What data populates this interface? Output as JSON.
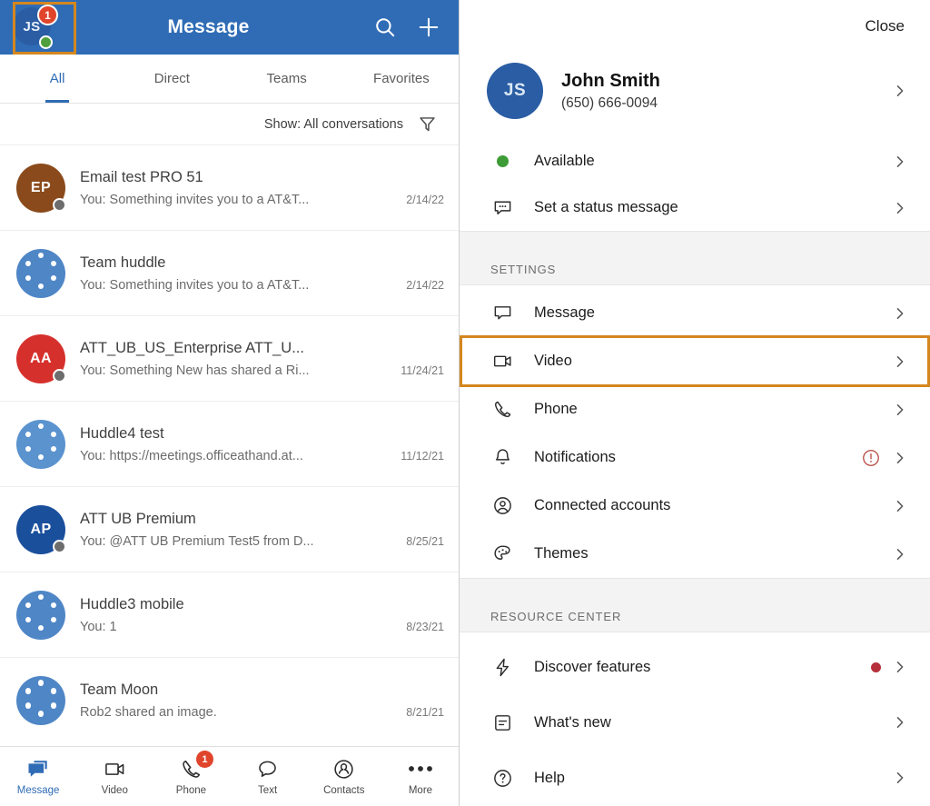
{
  "left": {
    "header": {
      "title": "Message",
      "avatar_initials": "JS",
      "badge_count": "1",
      "search_icon": "search-icon",
      "add_icon": "plus-icon"
    },
    "tabs": [
      {
        "label": "All",
        "active": true
      },
      {
        "label": "Direct",
        "active": false
      },
      {
        "label": "Teams",
        "active": false
      },
      {
        "label": "Favorites",
        "active": false
      }
    ],
    "filter": {
      "label": "Show: All conversations",
      "icon": "filter-funnel-icon"
    },
    "conversations": [
      {
        "title": "Email test PRO 51",
        "snippet": "You: Something invites you to a AT&T...",
        "date": "2/14/22",
        "avatar_type": "initials",
        "initials": "EP",
        "color": "#8a4a1b",
        "presence": true
      },
      {
        "title": "Team huddle",
        "snippet": "You: Something invites you to a AT&T...",
        "date": "2/14/22",
        "avatar_type": "team",
        "initials": "",
        "color": "#4f86c6",
        "presence": false
      },
      {
        "title": "ATT_UB_US_Enterprise ATT_U...",
        "snippet": "You: Something New has shared a Ri...",
        "date": "11/24/21",
        "avatar_type": "initials",
        "initials": "AA",
        "color": "#d6302c",
        "presence": true
      },
      {
        "title": "Huddle4 test",
        "snippet": "You: https://meetings.officeathand.at...",
        "date": "11/12/21",
        "avatar_type": "team",
        "initials": "",
        "color": "#5b93cf",
        "presence": false
      },
      {
        "title": "ATT UB Premium",
        "snippet": "You: @ATT UB Premium Test5 from D...",
        "date": "8/25/21",
        "avatar_type": "initials",
        "initials": "AP",
        "color": "#1a4f9c",
        "presence": true
      },
      {
        "title": "Huddle3 mobile",
        "snippet": "You: 1",
        "date": "8/23/21",
        "avatar_type": "team",
        "initials": "",
        "color": "#4f86c6",
        "presence": false
      },
      {
        "title": "Team Moon",
        "snippet": "Rob2 shared an image.",
        "date": "8/21/21",
        "avatar_type": "team",
        "initials": "",
        "color": "#4f86c6",
        "presence": false
      }
    ],
    "bottom_nav": [
      {
        "label": "Message",
        "icon": "message-icon",
        "active": true,
        "badge": ""
      },
      {
        "label": "Video",
        "icon": "video-camera-icon",
        "active": false,
        "badge": ""
      },
      {
        "label": "Phone",
        "icon": "phone-handset-icon",
        "active": false,
        "badge": "1"
      },
      {
        "label": "Text",
        "icon": "speech-bubble-icon",
        "active": false,
        "badge": ""
      },
      {
        "label": "Contacts",
        "icon": "contacts-person-icon",
        "active": false,
        "badge": ""
      },
      {
        "label": "More",
        "icon": "ellipsis-icon",
        "active": false,
        "badge": ""
      }
    ]
  },
  "right": {
    "close_label": "Close",
    "profile": {
      "initials": "JS",
      "name": "John Smith",
      "phone": "(650) 666-0094"
    },
    "status": {
      "label": "Available",
      "dot_color": "#3d9c35"
    },
    "status_message": {
      "label": "Set a status message",
      "icon": "status-message-icon"
    },
    "settings_header": "SETTINGS",
    "settings_items": [
      {
        "label": "Message",
        "icon": "message-bubble-icon",
        "badge": "",
        "highlight": false
      },
      {
        "label": "Video",
        "icon": "video-camera-icon",
        "badge": "",
        "highlight": true
      },
      {
        "label": "Phone",
        "icon": "phone-handset-icon",
        "badge": "",
        "highlight": false
      },
      {
        "label": "Notifications",
        "icon": "bell-icon",
        "badge": "warning",
        "highlight": false
      },
      {
        "label": "Connected accounts",
        "icon": "person-circle-icon",
        "badge": "",
        "highlight": false
      },
      {
        "label": "Themes",
        "icon": "palette-icon",
        "badge": "",
        "highlight": false
      }
    ],
    "resource_header": "RESOURCE CENTER",
    "resource_items": [
      {
        "label": "Discover features",
        "icon": "lightning-bolt-icon",
        "badge": "dot"
      },
      {
        "label": "What's new",
        "icon": "document-lines-icon",
        "badge": ""
      },
      {
        "label": "Help",
        "icon": "question-circle-icon",
        "badge": ""
      }
    ]
  },
  "colors": {
    "header_blue": "#2f6cb5",
    "highlight_orange": "#d4871f",
    "badge_red": "#e0452c",
    "presence_green": "#4fa03d"
  }
}
